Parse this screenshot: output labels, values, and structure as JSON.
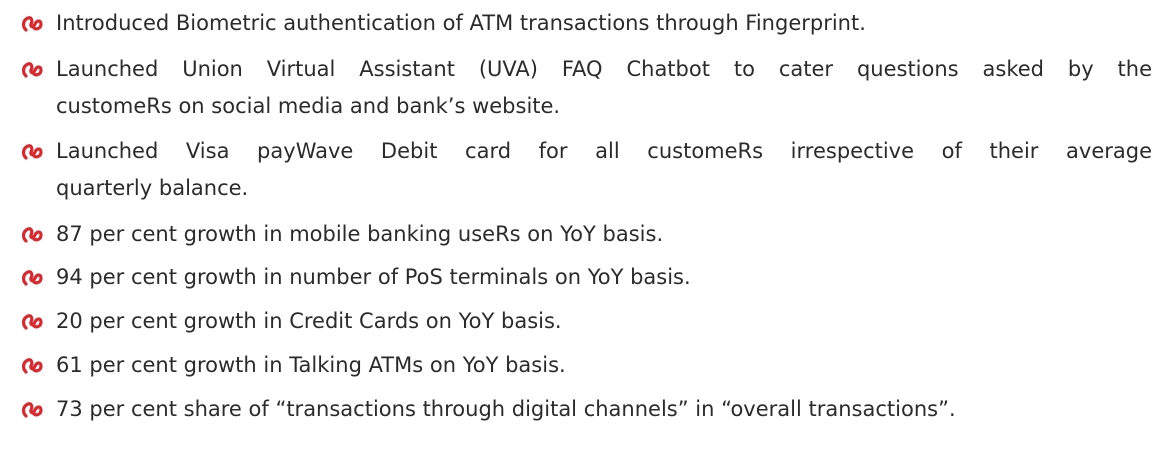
{
  "icons": {
    "bullet": "union-bank-logo-icon",
    "bullet_color": "#d9282e"
  },
  "items": [
    {
      "lines": [
        "Introduced Biometric authentication of ATM transactions through Fingerprint."
      ]
    },
    {
      "lines": [
        "Launched Union Virtual Assistant (UVA) FAQ Chatbot to cater questions asked by the",
        "customeRs  on social media and bank’s website."
      ]
    },
    {
      "lines": [
        "Launched Visa payWave Debit card for all customeRs  irrespective of their average",
        "quarterly balance."
      ]
    },
    {
      "lines": [
        "87 per cent growth in mobile banking useRs  on YoY basis."
      ]
    },
    {
      "lines": [
        "94 per cent growth in number of PoS terminals on YoY basis."
      ]
    },
    {
      "lines": [
        "20 per cent growth in Credit Cards on YoY basis."
      ]
    },
    {
      "lines": [
        "61 per cent growth in Talking ATMs on YoY basis."
      ]
    },
    {
      "lines": [
        "73 per cent share of “transactions through digital channels” in “overall transactions”."
      ]
    }
  ]
}
